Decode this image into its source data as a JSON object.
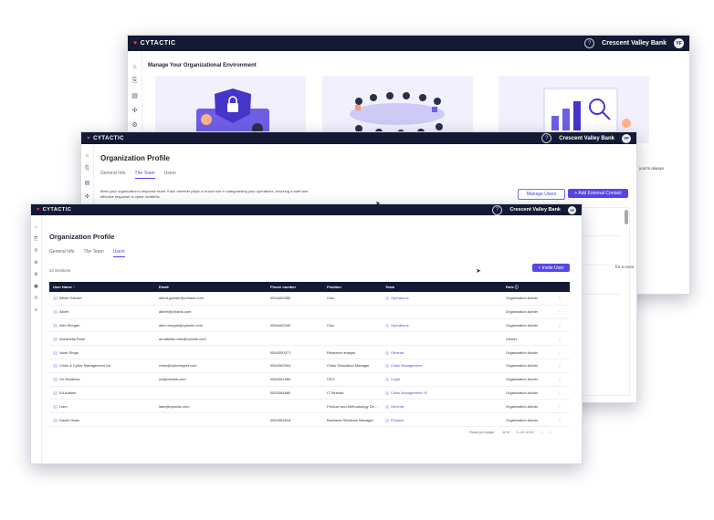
{
  "app": {
    "brand": "CYTACTIC",
    "org_name": "Crescent Valley Bank",
    "user_initials": "YF"
  },
  "window1": {
    "section_title": "Manage Your Organizational Environment",
    "side_texts": [
      "you're always",
      "for a more"
    ]
  },
  "window2": {
    "page_title": "Organization Profile",
    "tabs": [
      "General Info",
      "The Team",
      "Users"
    ],
    "description": "Meet your organization's response team. Each member plays a crucial role in safeguarding your operations, ensuring a swift and effective response to cyber incidents.",
    "buttons": {
      "manage_users": "Manage Users",
      "add_external_contact": "+ Add External Contact"
    }
  },
  "window3": {
    "page_title": "Organization Profile",
    "tabs": [
      "General Info",
      "The Team",
      "Users"
    ],
    "members_count": "23 members",
    "invite_button": "+ Invite User",
    "columns": [
      "User Name",
      "Email",
      "Phone number",
      "Position",
      "Team",
      "Role"
    ],
    "rows": [
      {
        "name": "Albert Gander",
        "email": "albert.gander@cvbank.com",
        "phone": "0504463456",
        "position": "Ciso",
        "team": "Operations",
        "role": "Organization Admin"
      },
      {
        "name": "Albert",
        "email": "albert@cvbank.com",
        "phone": "",
        "position": "",
        "team": "",
        "role": "Organization Admin"
      },
      {
        "name": "Alex Morgan",
        "email": "alex.morgan@cytactic.com",
        "phone": "0504462340",
        "position": "Ciso",
        "team": "Operations",
        "role": "Organization Admin"
      },
      {
        "name": "Annabella Rose",
        "email": "annabella.rose@cvbank.com",
        "phone": "",
        "position": "",
        "team": "",
        "role": "Viewer"
      },
      {
        "name": "Noah Singh",
        "email": "",
        "phone": "0504350071",
        "position": "Research analyst",
        "team": "General",
        "role": "Organization Admin"
      },
      {
        "name": "Crisis & Cyber Management Inc",
        "email": "crisis@cybermgmt.com",
        "phone": "0504362904",
        "position": "Crisis Simulation Manager",
        "team": "Crisis Management",
        "role": "Organization Admin"
      },
      {
        "name": "Oz Almarkov",
        "email": "oz@cvbank.com",
        "phone": "0504361980",
        "position": "CEO",
        "team": "Legal",
        "role": "Organization Admin"
      },
      {
        "name": "Ed Adams",
        "email": "",
        "phone": "0504364680",
        "position": "IT Director",
        "team": "Crisis Management",
        "team_extra": "+2",
        "role": "Organization Admin"
      },
      {
        "name": "Liam",
        "email": "liam@cytactic.com",
        "phone": "",
        "position": "Product and Methodology Director",
        "team": "General",
        "role": "Organization Admin"
      },
      {
        "name": "Daniel Haas",
        "email": "",
        "phone": "0504364518",
        "position": "Business Relations Manager",
        "team": "Finance",
        "role": "Organization Admin"
      }
    ],
    "pager": {
      "rows_label": "Rows per page:",
      "rows_value": "10",
      "range": "1–10 of 23"
    }
  }
}
